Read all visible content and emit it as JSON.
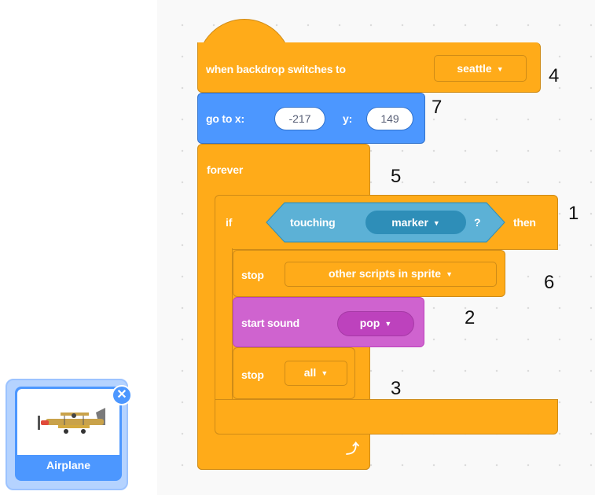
{
  "sprite": {
    "name": "Airplane",
    "close_icon": "x-icon"
  },
  "script": {
    "hat": {
      "label": "when backdrop switches to",
      "backdrop": "seattle"
    },
    "goto": {
      "label_x": "go to x:",
      "x": "-217",
      "label_y": "y:",
      "y": "149"
    },
    "forever": {
      "label": "forever"
    },
    "if_block": {
      "label_if": "if",
      "label_then": "then",
      "condition": {
        "label": "touching",
        "target": "marker",
        "suffix": "?"
      }
    },
    "stop1": {
      "label": "stop",
      "option": "other scripts in sprite"
    },
    "sound": {
      "label": "start sound",
      "sound": "pop"
    },
    "stop2": {
      "label": "stop",
      "option": "all"
    }
  },
  "annotations": {
    "hat": "4",
    "goto": "7",
    "forever": "5",
    "if": "1",
    "stop1": "6",
    "sound": "2",
    "stop2": "3"
  },
  "colors": {
    "control": "#ffab19",
    "motion": "#4c97ff",
    "sound": "#cf63cf",
    "sensing": "#5cb1d6"
  }
}
